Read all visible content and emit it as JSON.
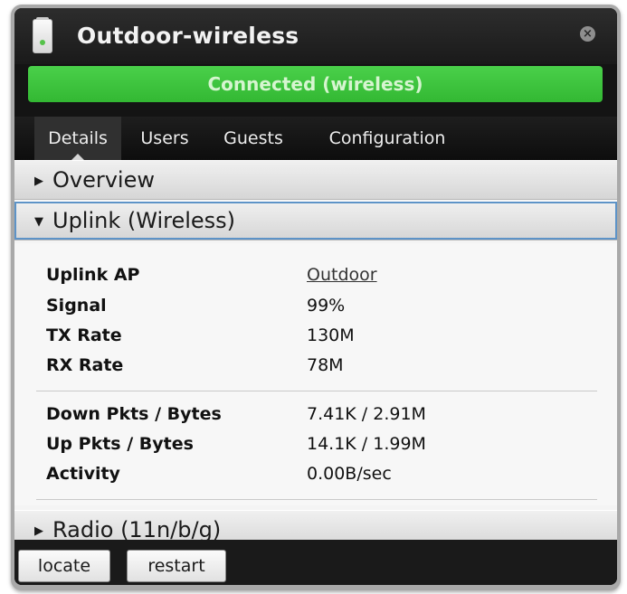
{
  "header": {
    "title": "Outdoor-wireless",
    "device_icon": "access-point-icon",
    "close_icon": "close-icon"
  },
  "status": {
    "text": "Connected (wireless)",
    "color": "#3cc43c"
  },
  "tabs": [
    {
      "label": "Details",
      "active": true
    },
    {
      "label": "Users",
      "active": false
    },
    {
      "label": "Guests",
      "active": false
    },
    {
      "label": "Configuration",
      "active": false
    }
  ],
  "sections": {
    "overview": {
      "label": "Overview",
      "expanded": false
    },
    "uplink": {
      "label": "Uplink (Wireless)",
      "expanded": true
    },
    "radio": {
      "label": "Radio (11n/b/g)",
      "expanded": false
    }
  },
  "uplink_rows": {
    "group1": [
      {
        "label": "Uplink AP",
        "value": "Outdoor"
      },
      {
        "label": "Signal",
        "value": "99%"
      },
      {
        "label": "TX Rate",
        "value": "130M"
      },
      {
        "label": "RX Rate",
        "value": "78M"
      }
    ],
    "group2": [
      {
        "label": "Down Pkts / Bytes",
        "value": "7.41K / 2.91M"
      },
      {
        "label": "Up Pkts / Bytes",
        "value": "14.1K / 1.99M"
      },
      {
        "label": "Activity",
        "value": "0.00B/sec"
      }
    ]
  },
  "actions": {
    "locate": "locate",
    "restart": "restart"
  },
  "colors": {
    "accent_selection": "#5d93c7",
    "panel_bg": "#141414"
  }
}
